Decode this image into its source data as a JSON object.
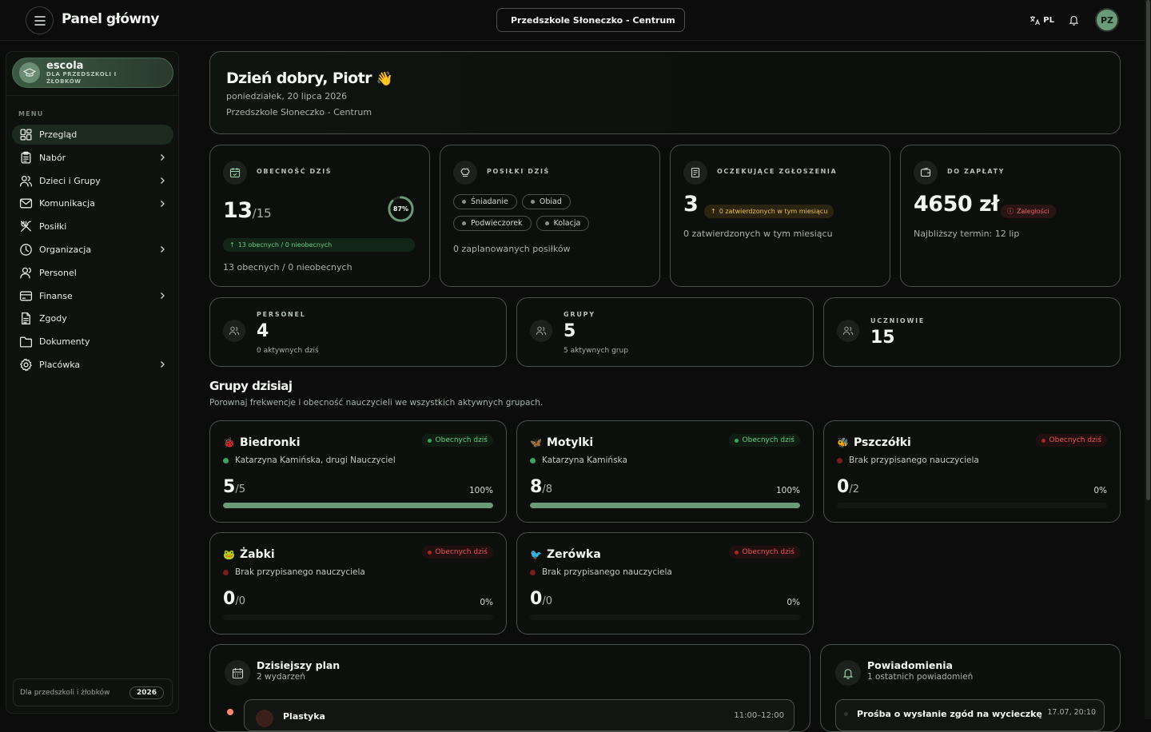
{
  "header": {
    "title": "Panel główny",
    "facility": "Przedszkole Słoneczko - Centrum",
    "language": "PL",
    "avatar_initials": "PZ"
  },
  "sidebar": {
    "brand_name": "escola",
    "brand_tagline": "DLA PRZEDSZKOLI I ŻŁOBKÓW",
    "menu_label": "MENU",
    "items": [
      {
        "label": "Przegląd",
        "icon": "grid-icon",
        "chevron": false
      },
      {
        "label": "Nabór",
        "icon": "clipboard-icon",
        "chevron": true
      },
      {
        "label": "Dzieci i Grupy",
        "icon": "users-icon",
        "chevron": true
      },
      {
        "label": "Komunikacja",
        "icon": "mail-icon",
        "chevron": true
      },
      {
        "label": "Posiłki",
        "icon": "utensils-icon",
        "chevron": false
      },
      {
        "label": "Organizacja",
        "icon": "clock-icon",
        "chevron": true
      },
      {
        "label": "Personel",
        "icon": "staff-icon",
        "chevron": false
      },
      {
        "label": "Finanse",
        "icon": "card-icon",
        "chevron": true
      },
      {
        "label": "Zgody",
        "icon": "document-icon",
        "chevron": false
      },
      {
        "label": "Dokumenty",
        "icon": "folder-icon",
        "chevron": false
      },
      {
        "label": "Placówka",
        "icon": "gear-icon",
        "chevron": true
      }
    ],
    "footer_text": "Dla przedszkoli i żłobków",
    "footer_year": "2026"
  },
  "greeting": {
    "title": "Dzień dobry, Piotr",
    "emoji": "👋",
    "date": "poniedziałek, 20 lipca 2026",
    "facility": "Przedszkole Słoneczko - Centrum"
  },
  "stats": {
    "attendance": {
      "title": "OBECNOŚĆ DZIŚ",
      "present": "13",
      "total": "/15",
      "percent_label": "87%",
      "percent_value": 0.87,
      "pill": "13 obecnych / 0 nieobecnych",
      "footer": "13 obecnych / 0 nieobecnych"
    },
    "meals": {
      "title": "POSIŁKI DZIŚ",
      "chips": [
        "Śniadanie",
        "Obiad",
        "Podwieczorek",
        "Kolacja"
      ],
      "footer": "0 zaplanowanych posiłków"
    },
    "pending": {
      "title": "OCZEKUJĄCE ZGŁOSZENIA",
      "value": "3",
      "pill": "0 zatwierdzonych w tym miesiącu",
      "footer": "0 zatwierdzonych w tym miesiącu"
    },
    "payments": {
      "title": "DO ZAPŁATY",
      "value": "4650 zł",
      "pill": "Zaległości",
      "footer": "Najbliższy termin: 12 lip"
    }
  },
  "mini_stats": [
    {
      "title": "PERSONEL",
      "value": "4",
      "sub": "0 aktywnych dziś"
    },
    {
      "title": "GRUPY",
      "value": "5",
      "sub": "5 aktywnych grup"
    },
    {
      "title": "UCZNIOWIE",
      "value": "15",
      "sub": ""
    }
  ],
  "groups_section": {
    "title": "Grupy dzisiaj",
    "subtitle": "Porownaj frekwencje i obecność nauczycieli we wszystkich aktywnych grupach."
  },
  "groups": [
    {
      "emoji": "🐞",
      "name": "Biedronki",
      "badge": "Obecnych dziś",
      "status": "green",
      "teacher": "Katarzyna Kamińska, drugi Nauczyciel",
      "present": "5",
      "total": "/5",
      "pct": "100%",
      "fill": 1.0
    },
    {
      "emoji": "🦋",
      "name": "Motylki",
      "badge": "Obecnych dziś",
      "status": "green",
      "teacher": "Katarzyna Kamińska",
      "present": "8",
      "total": "/8",
      "pct": "100%",
      "fill": 1.0
    },
    {
      "emoji": "🐝",
      "name": "Pszczółki",
      "badge": "Obecnych dziś",
      "status": "red",
      "teacher": "Brak przypisanego nauczyciela",
      "present": "0",
      "total": "/2",
      "pct": "0%",
      "fill": 0
    },
    {
      "emoji": "🐸",
      "name": "Żabki",
      "badge": "Obecnych dziś",
      "status": "red",
      "teacher": "Brak przypisanego nauczyciela",
      "present": "0",
      "total": "/0",
      "pct": "0%",
      "fill": 0
    },
    {
      "emoji": "🐦",
      "name": "Zerówka",
      "badge": "Obecnych dziś",
      "status": "red",
      "teacher": "Brak przypisanego nauczyciela",
      "present": "0",
      "total": "/0",
      "pct": "0%",
      "fill": 0
    }
  ],
  "plan": {
    "title": "Dzisiejszy plan",
    "subtitle": "2 wydarzeń",
    "events": [
      {
        "name": "Plastyka",
        "time": "11:00–12:00"
      }
    ]
  },
  "notifications": {
    "title": "Powiadomienia",
    "subtitle": "1 ostatnich powiadomień",
    "items": [
      {
        "text": "Prośba o wysłanie zgód na wycieczkę",
        "time": "17.07, 20:10"
      }
    ]
  },
  "colors": {
    "accent": "#6b9a78",
    "success": "#5fd17e",
    "danger": "#f05555",
    "warning": "#f0c14a"
  }
}
